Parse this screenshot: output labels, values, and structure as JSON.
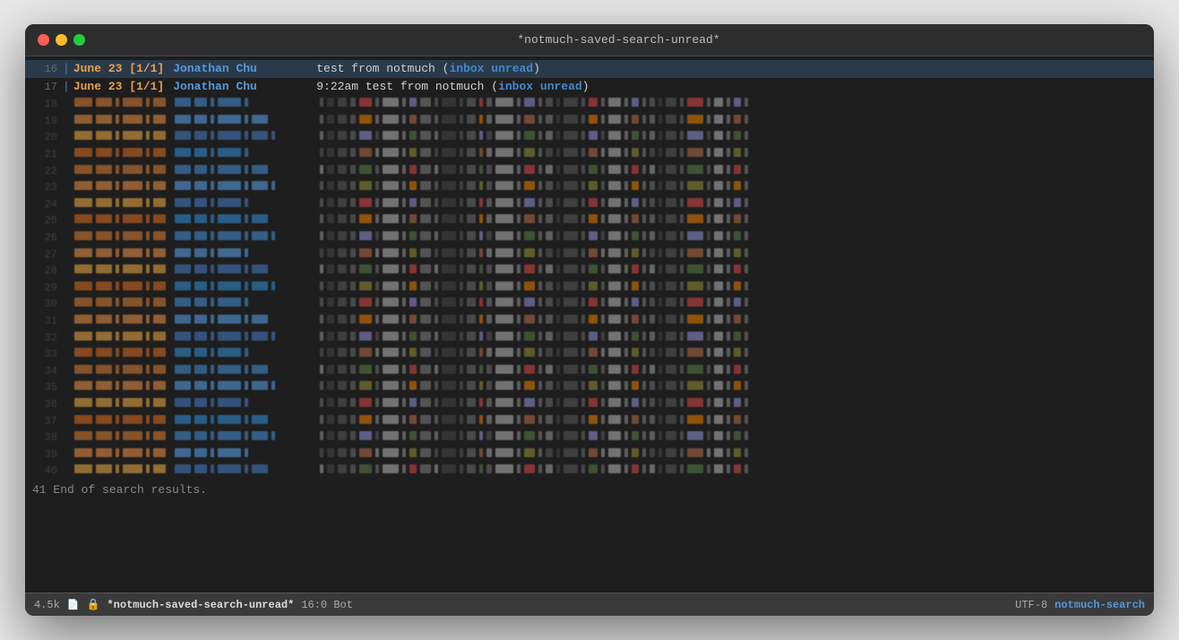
{
  "window": {
    "title": "*notmuch-saved-search-unread*",
    "traffic_lights": [
      "red",
      "yellow",
      "green"
    ]
  },
  "rows": [
    {
      "num": "16",
      "bar": "|",
      "date": "June 23 [1/1]",
      "sender": "Jonathan Chu",
      "subject": "test from notmuch (",
      "tags": [
        "inbox",
        " ",
        "unread"
      ],
      "subject_end": ")",
      "highlight": true
    },
    {
      "num": "17",
      "bar": "|",
      "date": "June 23 [1/1]",
      "sender": "Jonathan Chu",
      "subject": "9:22am test from notmuch (",
      "tags": [
        "inbox",
        " ",
        "unread"
      ],
      "subject_end": ")",
      "highlight": false
    }
  ],
  "blurred_rows": [
    {
      "num": "18",
      "date_w": 80,
      "sender_w": 130,
      "subject_w": 700,
      "date_color": "#cc7733",
      "sender_color": "#4488cc",
      "subject_color": "#666"
    },
    {
      "num": "19",
      "date_w": 75,
      "sender_w": 90,
      "subject_w": 650,
      "date_color": "#dd8844",
      "sender_color": "#4488cc",
      "subject_color": "#777"
    },
    {
      "num": "20",
      "date_w": 80,
      "sender_w": 160,
      "subject_w": 580,
      "date_color": "#cc7733",
      "sender_color": "#5599cc",
      "subject_color": "#888"
    },
    {
      "num": "21",
      "date_w": 75,
      "sender_w": 80,
      "subject_w": 600,
      "date_color": "#dd8844",
      "sender_color": "#4488cc",
      "subject_color": "#666"
    },
    {
      "num": "22",
      "date_w": 80,
      "sender_w": 140,
      "subject_w": 620,
      "date_color": "#cc7733",
      "sender_color": "#5588bb",
      "subject_color": "#777"
    },
    {
      "num": "23",
      "date_w": 75,
      "sender_w": 90,
      "subject_w": 580,
      "date_color": "#dd8844",
      "sender_color": "#4488cc",
      "subject_color": "#888"
    },
    {
      "num": "24",
      "date_w": 80,
      "sender_w": 130,
      "subject_w": 700,
      "date_color": "#cc7733",
      "sender_color": "#5599cc",
      "subject_color": "#666"
    },
    {
      "num": "25",
      "date_w": 75,
      "sender_w": 140,
      "subject_w": 650,
      "date_color": "#dd8844",
      "sender_color": "#4488cc",
      "subject_color": "#777"
    },
    {
      "num": "26",
      "date_w": 80,
      "sender_w": 80,
      "subject_w": 580,
      "date_color": "#cc7733",
      "sender_color": "#5588bb",
      "subject_color": "#888"
    },
    {
      "num": "27",
      "date_w": 75,
      "sender_w": 130,
      "subject_w": 600,
      "date_color": "#dd8844",
      "sender_color": "#4488cc",
      "subject_color": "#666"
    },
    {
      "num": "28",
      "date_w": 80,
      "sender_w": 160,
      "subject_w": 620,
      "date_color": "#cc7733",
      "sender_color": "#5599cc",
      "subject_color": "#777"
    },
    {
      "num": "29",
      "date_w": 75,
      "sender_w": 90,
      "subject_w": 580,
      "date_color": "#dd8844",
      "sender_color": "#4488cc",
      "subject_color": "#888"
    },
    {
      "num": "30",
      "date_w": 80,
      "sender_w": 140,
      "subject_w": 700,
      "date_color": "#cc7733",
      "sender_color": "#5588bb",
      "subject_color": "#666"
    },
    {
      "num": "31",
      "date_w": 75,
      "sender_w": 80,
      "subject_w": 650,
      "date_color": "#dd8844",
      "sender_color": "#4488cc",
      "subject_color": "#777"
    },
    {
      "num": "32",
      "date_w": 80,
      "sender_w": 130,
      "subject_w": 580,
      "date_color": "#cc7733",
      "sender_color": "#5599cc",
      "subject_color": "#888"
    },
    {
      "num": "33",
      "date_w": 75,
      "sender_w": 140,
      "subject_w": 600,
      "date_color": "#dd8844",
      "sender_color": "#4488cc",
      "subject_color": "#666"
    },
    {
      "num": "34",
      "date_w": 80,
      "sender_w": 90,
      "subject_w": 620,
      "date_color": "#cc7733",
      "sender_color": "#5588bb",
      "subject_color": "#777"
    },
    {
      "num": "35",
      "date_w": 75,
      "sender_w": 130,
      "subject_w": 700,
      "date_color": "#dd8844",
      "sender_color": "#4488cc",
      "subject_color": "#888"
    },
    {
      "num": "36",
      "date_w": 80,
      "sender_w": 160,
      "subject_w": 580,
      "date_color": "#cc7733",
      "sender_color": "#5599cc",
      "subject_color": "#666"
    },
    {
      "num": "37",
      "date_w": 75,
      "sender_w": 80,
      "subject_w": 600,
      "date_color": "#dd8844",
      "sender_color": "#4488cc",
      "subject_color": "#777"
    },
    {
      "num": "38",
      "date_w": 80,
      "sender_w": 130,
      "subject_w": 620,
      "date_color": "#cc7733",
      "sender_color": "#5588bb",
      "subject_color": "#888"
    },
    {
      "num": "39",
      "date_w": 75,
      "sender_w": 140,
      "subject_w": 580,
      "date_color": "#dd8844",
      "sender_color": "#4488cc",
      "subject_color": "#666"
    },
    {
      "num": "40",
      "date_w": 80,
      "sender_w": 90,
      "subject_w": 700,
      "date_color": "#cc7733",
      "sender_color": "#5599cc",
      "subject_color": "#777"
    }
  ],
  "end_line": "41  End of search results.",
  "statusbar": {
    "size": "4.5k",
    "file_icon": "📄",
    "lock_icon": "🔒",
    "filename": "*notmuch-saved-search-unread*",
    "position": "16:0  Bot",
    "encoding": "UTF-8",
    "mode": "notmuch-search"
  }
}
